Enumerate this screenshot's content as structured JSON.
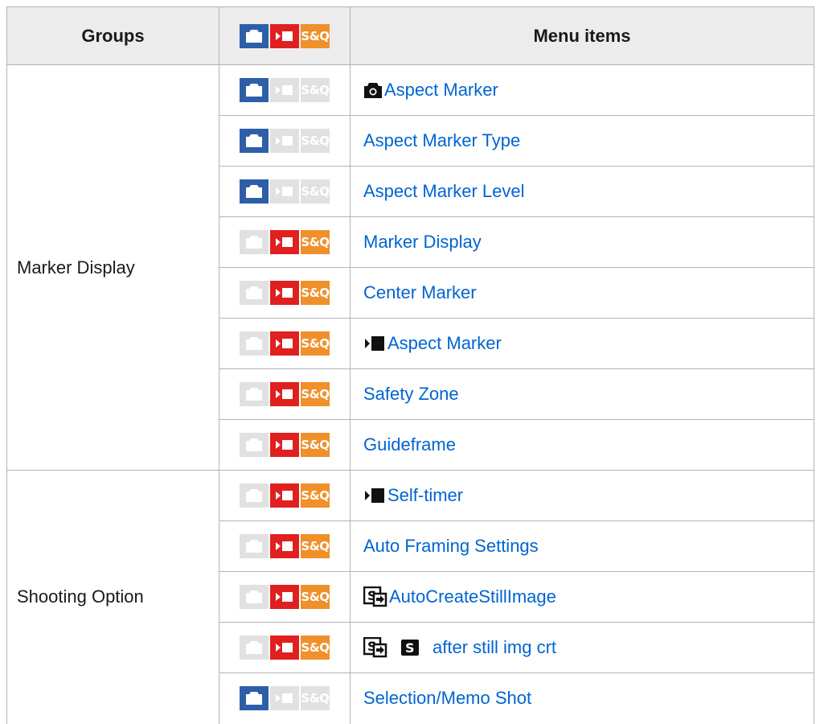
{
  "header": {
    "groups": "Groups",
    "menu_items": "Menu items",
    "mode_labels": {
      "photo": "photo-mode-icon",
      "movie": "movie-mode-icon",
      "sq": "S&Q"
    }
  },
  "colors": {
    "photo_on": "#2d5fa8",
    "movie_on": "#e02020",
    "sq_on": "#f0902a",
    "off": "#e1e1e1",
    "link": "#0064d2",
    "header_bg": "#ececec",
    "border": "#b3b3b3"
  },
  "groups": [
    {
      "name": "Marker Display",
      "rowspan": 8
    },
    {
      "name": "Shooting Option",
      "rowspan": 5
    }
  ],
  "rows": [
    {
      "label": "Aspect Marker",
      "prefix": "camera-icon",
      "modes": {
        "photo": true,
        "movie": false,
        "sq": false
      }
    },
    {
      "label": "Aspect Marker Type",
      "prefix": "",
      "modes": {
        "photo": true,
        "movie": false,
        "sq": false
      }
    },
    {
      "label": "Aspect Marker Level",
      "prefix": "",
      "modes": {
        "photo": true,
        "movie": false,
        "sq": false
      }
    },
    {
      "label": "Marker Display",
      "prefix": "",
      "modes": {
        "photo": false,
        "movie": true,
        "sq": true
      }
    },
    {
      "label": "Center Marker",
      "prefix": "",
      "modes": {
        "photo": false,
        "movie": true,
        "sq": true
      }
    },
    {
      "label": "Aspect Marker",
      "prefix": "movie-icon",
      "modes": {
        "photo": false,
        "movie": true,
        "sq": true
      }
    },
    {
      "label": "Safety Zone",
      "prefix": "",
      "modes": {
        "photo": false,
        "movie": true,
        "sq": true
      }
    },
    {
      "label": "Guideframe",
      "prefix": "",
      "modes": {
        "photo": false,
        "movie": true,
        "sq": true
      }
    },
    {
      "label": "Self-timer",
      "prefix": "movie-icon",
      "modes": {
        "photo": false,
        "movie": true,
        "sq": true
      }
    },
    {
      "label": "Auto Framing Settings",
      "prefix": "",
      "modes": {
        "photo": false,
        "movie": true,
        "sq": true
      }
    },
    {
      "label": "AutoCreateStillImage",
      "prefix": "auto-create-still-icon",
      "modes": {
        "photo": false,
        "movie": true,
        "sq": true
      }
    },
    {
      "label": "after still img crt",
      "prefix": "auto-create-still-icon+still-s-icon",
      "modes": {
        "photo": false,
        "movie": true,
        "sq": true
      }
    },
    {
      "label": "Selection/Memo Shot",
      "prefix": "",
      "modes": {
        "photo": true,
        "movie": false,
        "sq": false
      }
    }
  ]
}
